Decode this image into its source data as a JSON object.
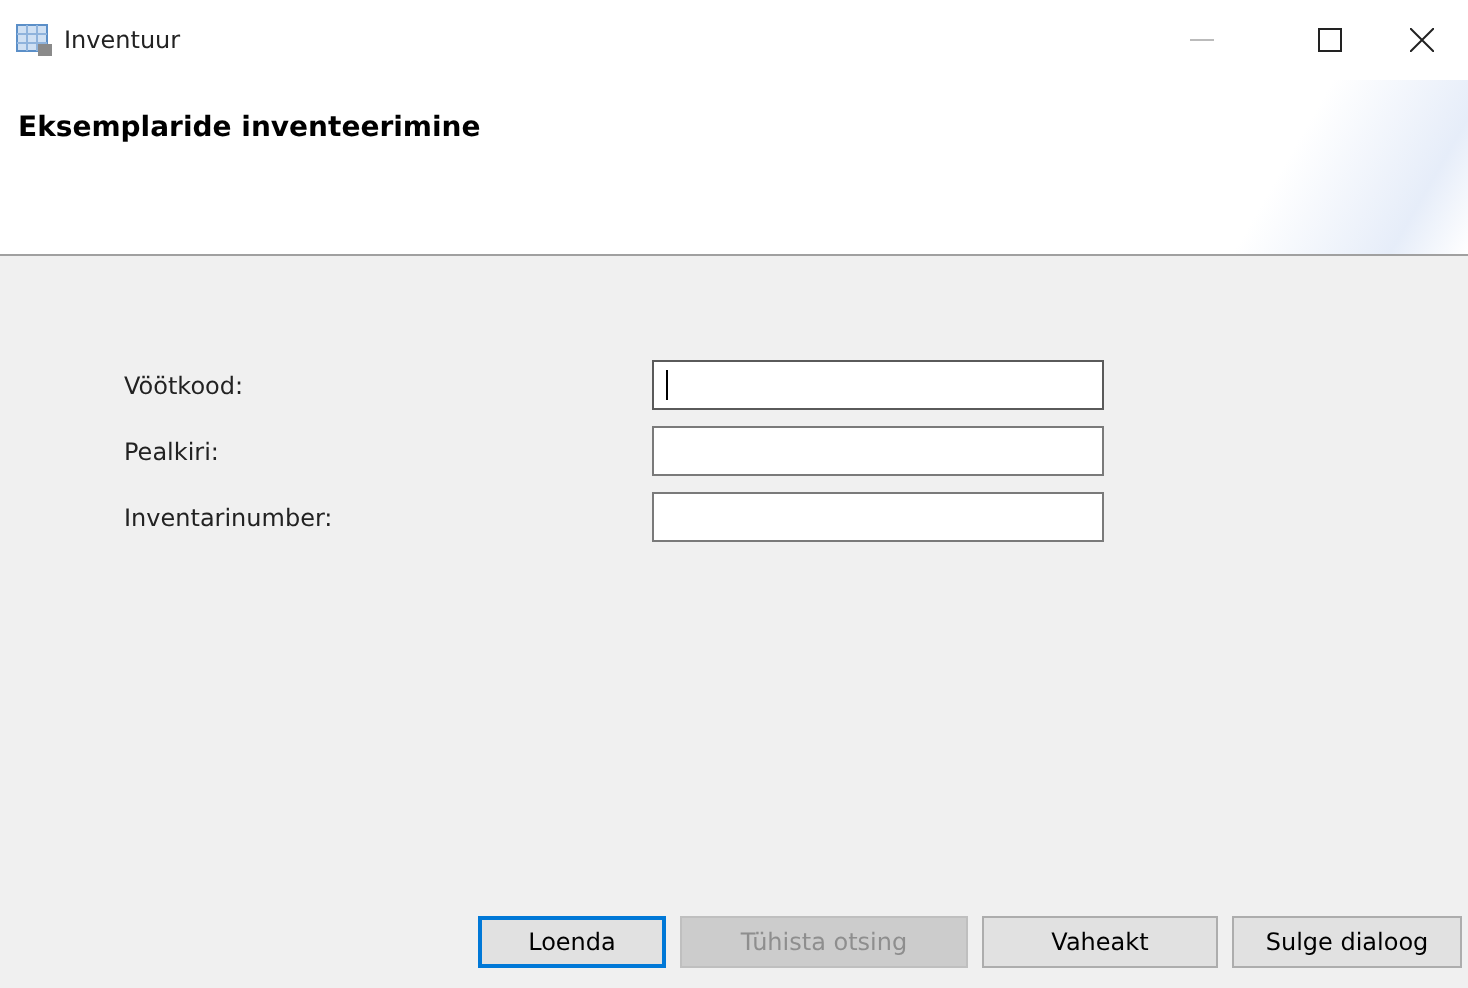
{
  "window": {
    "title": "Inventuur"
  },
  "header": {
    "title": "Eksemplaride inventeerimine"
  },
  "fields": [
    {
      "label": "Vöötkood:",
      "focused": true
    },
    {
      "label": "Pealkiri:",
      "focused": false
    },
    {
      "label": "Inventarinumber:",
      "focused": false
    }
  ],
  "buttons": [
    {
      "label": "Loenda",
      "disabled": false,
      "focused": true
    },
    {
      "label": "Tühista otsing",
      "disabled": true,
      "focused": false
    },
    {
      "label": "Vaheakt",
      "disabled": false,
      "focused": false
    },
    {
      "label": "Sulge dialoog",
      "disabled": false,
      "focused": false
    }
  ]
}
